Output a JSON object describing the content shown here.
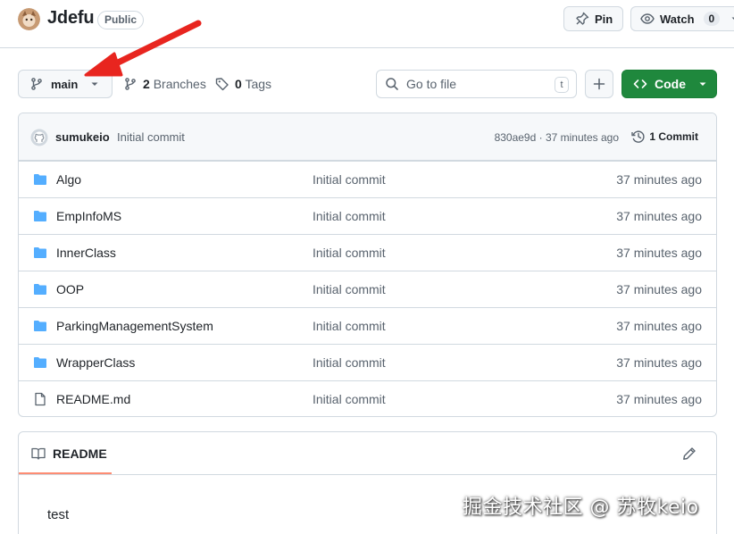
{
  "repo": {
    "name": "Jdefu",
    "visibility": "Public"
  },
  "header": {
    "pin_label": "Pin",
    "watch_label": "Watch",
    "watch_count": "0"
  },
  "toolbar": {
    "branch": "main",
    "branches_count": "2",
    "branches_label": "Branches",
    "tags_count": "0",
    "tags_label": "Tags",
    "goto_placeholder": "Go to file",
    "goto_shortcut": "t",
    "code_label": "Code"
  },
  "latest_commit": {
    "author": "sumukeio",
    "message": "Initial commit",
    "meta": "830ae9d · 37 minutes ago",
    "count_label": "1 Commit"
  },
  "files": [
    {
      "name": "Algo",
      "type": "folder",
      "message": "Initial commit",
      "date": "37 minutes ago"
    },
    {
      "name": "EmpInfoMS",
      "type": "folder",
      "message": "Initial commit",
      "date": "37 minutes ago"
    },
    {
      "name": "InnerClass",
      "type": "folder",
      "message": "Initial commit",
      "date": "37 minutes ago"
    },
    {
      "name": "OOP",
      "type": "folder",
      "message": "Initial commit",
      "date": "37 minutes ago"
    },
    {
      "name": "ParkingManagementSystem",
      "type": "folder",
      "message": "Initial commit",
      "date": "37 minutes ago"
    },
    {
      "name": "WrapperClass",
      "type": "folder",
      "message": "Initial commit",
      "date": "37 minutes ago"
    },
    {
      "name": "README.md",
      "type": "file",
      "message": "Initial commit",
      "date": "37 minutes ago"
    }
  ],
  "readme": {
    "tab_label": "README",
    "content": "test"
  },
  "watermark": "掘金技术社区 @ 苏牧keio",
  "colors": {
    "code_button": "#1f883d",
    "folder_icon": "#54aeff",
    "annotation_arrow": "#e8251f",
    "readme_tab_underline": "#fd8c73"
  }
}
